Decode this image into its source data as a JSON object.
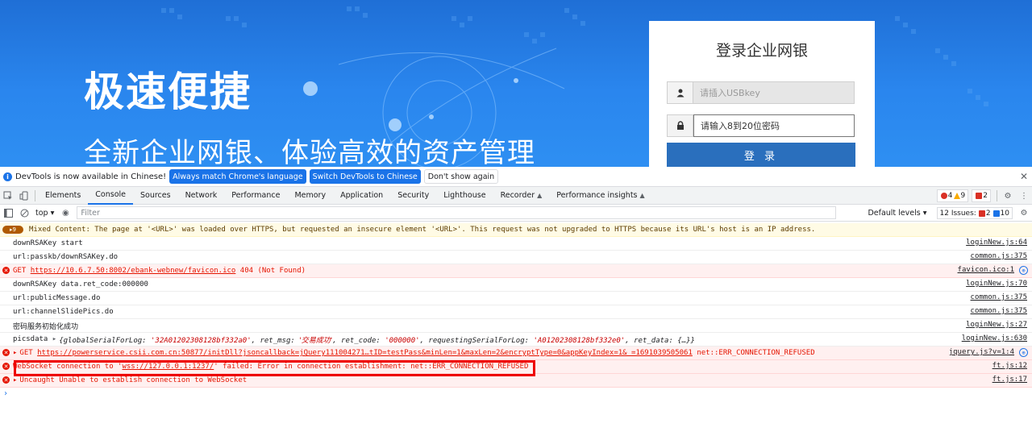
{
  "banner": {
    "slogan_main": "极速便捷",
    "slogan_sub": "全新企业网银、体验高效的资产管理"
  },
  "login": {
    "title": "登录企业网银",
    "usbkey_placeholder": "请插入USBkey",
    "password_placeholder": "请输入8到20位密码",
    "login_button": "登 录"
  },
  "infobar": {
    "text": "DevTools is now available in Chinese!",
    "btn_match": "Always match Chrome's language",
    "btn_switch": "Switch DevTools to Chinese",
    "btn_dismiss": "Don't show again"
  },
  "tabs": [
    {
      "label": "Elements"
    },
    {
      "label": "Console"
    },
    {
      "label": "Sources"
    },
    {
      "label": "Network"
    },
    {
      "label": "Performance"
    },
    {
      "label": "Memory"
    },
    {
      "label": "Application"
    },
    {
      "label": "Security"
    },
    {
      "label": "Lighthouse"
    },
    {
      "label": "Recorder"
    },
    {
      "label": "Performance insights"
    }
  ],
  "counts": {
    "errors": "4",
    "warnings": "9",
    "messages": "2"
  },
  "filterbar": {
    "context": "top ▾",
    "filter_placeholder": "Filter",
    "levels": "Default levels ▾",
    "issues_label": "12 Issues:",
    "issues_red": "2",
    "issues_blue": "10"
  },
  "console": {
    "warn_badge": "▸9",
    "warn_text": "Mixed Content: The page at '<URL>' was loaded over HTTPS, but requested an insecure element '<URL>'. This request was not upgraded to HTTPS because its URL's host is an IP address.",
    "rows": [
      {
        "text": "downRSAKey start",
        "src": "loginNew.js:64"
      },
      {
        "text": "url:passkb/downRSAKey.do",
        "src": "common.js:375"
      },
      {
        "src": "favicon.ico:1"
      },
      {
        "text": "downRSAKey data.ret_code:000000",
        "src": "loginNew.js:70"
      },
      {
        "text": "url:publicMessage.do",
        "src": "common.js:375"
      },
      {
        "text": "url:channelSlidePics.do",
        "src": "common.js:375"
      },
      {
        "text": "密码服务初始化成功",
        "src": "loginNew.js:27"
      },
      {
        "src": "loginNew.js:630"
      },
      {
        "src": "jquery.js?v=1:4"
      },
      {
        "src": "ft.js:12"
      },
      {
        "src": "ft.js:17"
      }
    ],
    "err1_get": "GET",
    "err1_url": "https://10.6.7.50:8002/ebank-webnew/favicon.ico",
    "err1_status": "404 (Not Found)",
    "pics_label": "picsdata",
    "pics_obj_1": "{globalSerialForLog: ",
    "pics_v1": "'32A01202308128bf332a0'",
    "pics_obj_2": ", ret_msg: ",
    "pics_v2": "'交易成功'",
    "pics_obj_3": ", ret_code: ",
    "pics_v3": "'000000'",
    "pics_obj_4": ", requestingSerialForLog: ",
    "pics_v4": "'A01202308128bf332e0'",
    "pics_obj_5": ", ret_data: {…}}",
    "err2_get": "GET",
    "err2_url": "https://powerservice.csii.com.cn:50877/initDll?jsoncallback=jQuery111004271…tID=testPass&minLen=1&maxLen=2&encryptType=0&appKeyIndex=1&_=1691039505061",
    "err2_status": "net::ERR_CONNECTION_REFUSED",
    "err3_a": "WebSocket connection to '",
    "err3_url": "wss://127.0.0.1:1237/",
    "err3_b": "' failed: Error in connection establishment: net::ERR_CONNECTION_REFUSED",
    "err4": "Uncaught Unable to establish connection to WebSocket"
  }
}
